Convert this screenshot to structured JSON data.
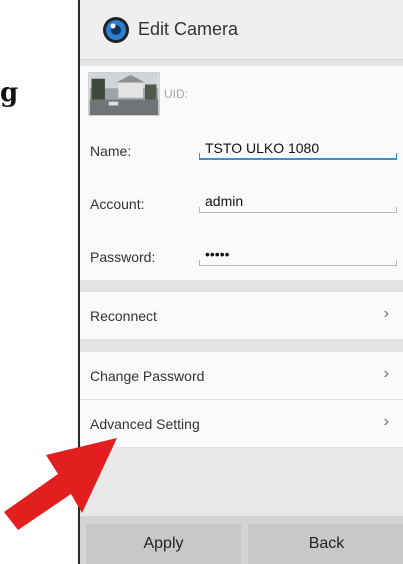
{
  "side_text": "g",
  "app": {
    "title": "Edit Camera",
    "icon": "camera-lens-icon"
  },
  "camera": {
    "uid_label": "UID:"
  },
  "form": {
    "name": {
      "label": "Name:",
      "value": "TSTO ULKO 1080"
    },
    "account": {
      "label": "Account:",
      "value": "admin"
    },
    "password": {
      "label": "Password:",
      "value": "•••••"
    }
  },
  "menu": [
    {
      "label": "Reconnect"
    },
    {
      "label": "Change Password"
    },
    {
      "label": "Advanced Setting"
    }
  ],
  "buttons": {
    "apply": "Apply",
    "back": "Back"
  },
  "colors": {
    "accent": "#3b8fd3",
    "arrow": "#e31e1e"
  }
}
